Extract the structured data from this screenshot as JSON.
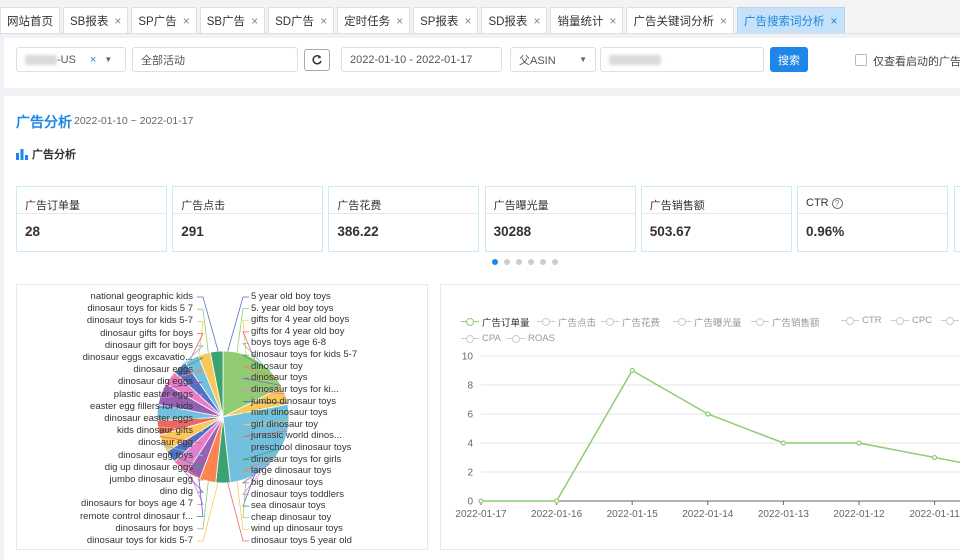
{
  "tabs": [
    {
      "label": "网站首页",
      "closable": false
    },
    {
      "label": "SB报表",
      "closable": true
    },
    {
      "label": "SP广告",
      "closable": true
    },
    {
      "label": "SB广告",
      "closable": true
    },
    {
      "label": "SD广告",
      "closable": true
    },
    {
      "label": "定时任务",
      "closable": true
    },
    {
      "label": "SP报表",
      "closable": true
    },
    {
      "label": "SD报表",
      "closable": true
    },
    {
      "label": "销量统计",
      "closable": true
    },
    {
      "label": "广告关键词分析",
      "closable": true
    },
    {
      "label": "广告搜索词分析",
      "closable": true,
      "active": true
    }
  ],
  "filters": {
    "store_suffix": "-US",
    "campaign": "全部活动",
    "date_range": "2022-01-10 - 2022-01-17",
    "asin_type": "父ASIN",
    "search_button": "搜索",
    "only_active_label": "仅查看启动的广告活动"
  },
  "section": {
    "title": "广告分析",
    "date_range": "2022-01-10 ~ 2022-01-17",
    "subtitle": "广告分析"
  },
  "kpis": [
    {
      "label": "广告订单量",
      "value": "28"
    },
    {
      "label": "广告点击",
      "value": "291"
    },
    {
      "label": "广告花费",
      "value": "386.22"
    },
    {
      "label": "广告曝光量",
      "value": "30288"
    },
    {
      "label": "广告销售额",
      "value": "503.67"
    },
    {
      "label": "CTR",
      "value": "0.96%",
      "help": true
    }
  ],
  "carousel": {
    "count": 6,
    "active": 0
  },
  "colors": {
    "accent": "#1e86e8",
    "line": "#91cc75"
  },
  "chart_data": [
    {
      "type": "pie",
      "labels_left": [
        "national geographic kids",
        "dinosaur toys for kids 5 7",
        "dinosaur toys for kids 5-7",
        "dinosaur gifts for boys",
        "dinosaur gift for boys",
        "dinosaur eggs excavatio...",
        "dinosaur eggs",
        "dinosaur dig eggs",
        "plastic easter eggs",
        "easter egg fillers for kids",
        "dinosaur easter eggs",
        "kids dinosaur gifts",
        "dinosaur egg",
        "dinosaur egg toys",
        "dig up dinosaur eggs",
        "jumbo dinosaur egg",
        "dino dig",
        "dinosaurs for boys age 4 7",
        "remote control dinosaur f...",
        "dinosaurs for boys",
        "dinosaur toys for kids 5-7"
      ],
      "labels_right": [
        "5 year old boy toys",
        "5. year old boy toys",
        "gifts for 4 year old boys",
        "gifts for 4 year old boy",
        "boys toys age 6-8",
        "dinosaur toys for kids 5-7",
        "dinosaur toy",
        "dinosaur toys",
        "dinosaur toys for ki...",
        "jumbo dinosaur toys",
        "mini dinosaur toys",
        "girl dinosaur toy",
        "jurassic world dinos...",
        "preschool dinosaur toys",
        "dinosaur toys for girls",
        "large dinosaur toys",
        "big dinosaur toys",
        "dinosaur toys toddlers",
        "sea dinosaur toys",
        "cheap dinosaur toy",
        "wind up dinosaur toys",
        "dinosaur toys 5 year old"
      ],
      "slices": [
        {
          "value": 4,
          "color": "#91cc75"
        },
        {
          "value": 1,
          "color": "#fac858"
        },
        {
          "value": 6,
          "color": "#73c0de"
        },
        {
          "value": 0.8,
          "color": "#3ba272"
        },
        {
          "value": 0.9,
          "color": "#fc8452"
        },
        {
          "value": 0.8,
          "color": "#9a60b4"
        },
        {
          "value": 0.9,
          "color": "#ea7ccc"
        },
        {
          "value": 0.7,
          "color": "#5470c6"
        },
        {
          "value": 1.0,
          "color": "#fac858"
        },
        {
          "value": 0.8,
          "color": "#ee6666"
        },
        {
          "value": 0.9,
          "color": "#73c0de"
        },
        {
          "value": 1.2,
          "color": "#9a60b4"
        },
        {
          "value": 0.8,
          "color": "#ea7ccc"
        },
        {
          "value": 0.8,
          "color": "#5470c6"
        },
        {
          "value": 0.8,
          "color": "#73c0de"
        },
        {
          "value": 0.7,
          "color": "#fac858"
        },
        {
          "value": 0.7,
          "color": "#3ba272"
        }
      ]
    },
    {
      "type": "line",
      "legend": [
        "广告订单量",
        "广告点击",
        "广告花费",
        "广告曝光量",
        "广告销售额",
        "CTR",
        "CPC",
        "CVR",
        "CPA",
        "ROAS"
      ],
      "legend_active": [
        0
      ],
      "x": [
        "2022-01-17",
        "2022-01-16",
        "2022-01-15",
        "2022-01-14",
        "2022-01-13",
        "2022-01-12",
        "2022-01-11",
        "2022-01-10"
      ],
      "series": [
        {
          "name": "广告订单量",
          "values": [
            0,
            0,
            9,
            6,
            4,
            4,
            3,
            2
          ]
        }
      ],
      "yticks": [
        0,
        2,
        4,
        6,
        8,
        10
      ],
      "ylim": [
        0,
        10
      ]
    }
  ]
}
